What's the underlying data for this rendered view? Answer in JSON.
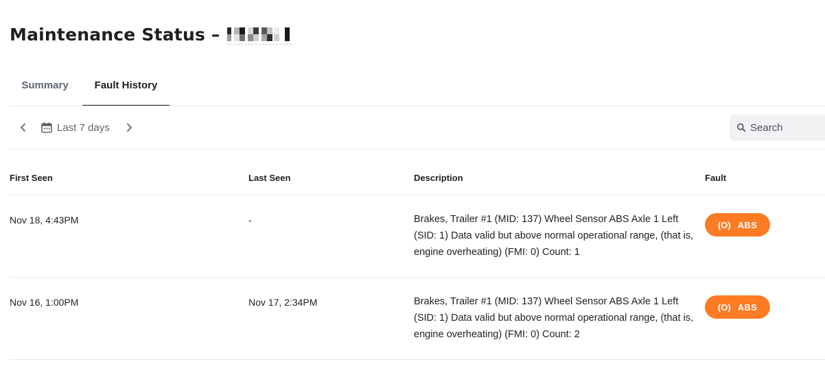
{
  "header": {
    "title": "Maintenance Status –"
  },
  "tabs": [
    {
      "label": "Summary",
      "active": false
    },
    {
      "label": "Fault History",
      "active": true
    }
  ],
  "toolbar": {
    "date_range": "Last 7 days",
    "prev_icon": "chevron-left-icon",
    "next_icon": "chevron-right-icon",
    "calendar_icon": "calendar-icon",
    "search": {
      "placeholder": "Search",
      "value": "",
      "icon": "search-icon"
    }
  },
  "table": {
    "columns": [
      "First Seen",
      "Last Seen",
      "Description",
      "Fault"
    ],
    "rows": [
      {
        "first_seen": "Nov 18, 4:43PM",
        "last_seen": "-",
        "description": "Brakes, Trailer #1 (MID: 137) Wheel Sensor ABS Axle 1 Left (SID: 1) Data valid but above normal operational range, (that is, engine overheating) (FMI: 0) Count: 1",
        "fault": {
          "icon_text": "(O)",
          "label": "ABS",
          "color": "#fd7b22"
        }
      },
      {
        "first_seen": "Nov 16, 1:00PM",
        "last_seen": "Nov 17, 2:34PM",
        "description": "Brakes, Trailer #1 (MID: 137) Wheel Sensor ABS Axle 1 Left (SID: 1) Data valid but above normal operational range, (that is, engine overheating) (FMI: 0) Count: 2",
        "fault": {
          "icon_text": "(O)",
          "label": "ABS",
          "color": "#fd7b22"
        }
      }
    ]
  },
  "colors": {
    "accent_orange": "#fd7b22",
    "muted_text": "#5d6670",
    "divider": "#e6e6e6",
    "search_bg": "#f1f2f4"
  }
}
